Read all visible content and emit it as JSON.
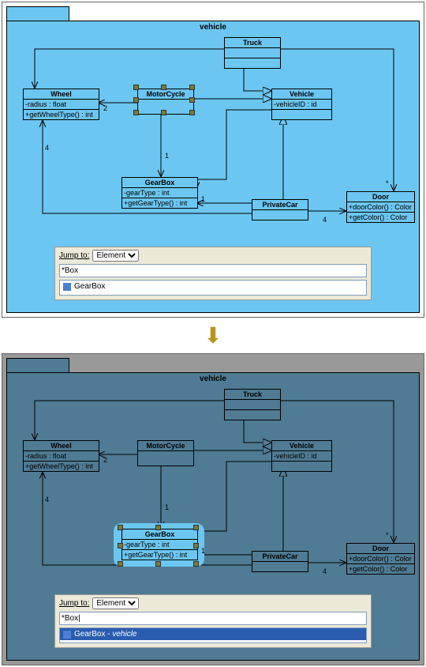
{
  "top": {
    "package": "vehicle",
    "classes": {
      "Truck": {
        "name": "Truck",
        "attrs": "",
        "ops": ""
      },
      "Wheel": {
        "name": "Wheel",
        "attrs": "-radius : float",
        "ops": "+getWheelType() : int"
      },
      "MotorCycle": {
        "name": "MotorCycle"
      },
      "Vehicle": {
        "name": "Vehicle",
        "attrs": "-vehicleID : id"
      },
      "GearBox": {
        "name": "GearBox",
        "attrs": "-gearType : int",
        "ops": "+getGearType() : int"
      },
      "PrivateCar": {
        "name": "PrivateCar"
      },
      "Door": {
        "name": "Door",
        "attrs": "+doorColor() : Color",
        "ops": "+getColor() : Color"
      }
    },
    "mults": {
      "m1": "2",
      "m2": "4",
      "m3": "1",
      "m4": "1",
      "m5": "4",
      "m6": "*"
    },
    "search": {
      "label": "Jump to:",
      "type": "Element",
      "query": "*Box",
      "result": "GearBox"
    }
  },
  "bottom": {
    "package": "vehicle",
    "classes": {
      "Truck": {
        "name": "Truck"
      },
      "Wheel": {
        "name": "Wheel",
        "attrs": "-radius : float",
        "ops": "+getWheelType() : int"
      },
      "MotorCycle": {
        "name": "MotorCycle"
      },
      "Vehicle": {
        "name": "Vehicle",
        "attrs": "-vehicleID : id"
      },
      "GearBox": {
        "name": "GearBox",
        "attrs": "-gearType : int",
        "ops": "+getGearType() : int"
      },
      "PrivateCar": {
        "name": "PrivateCar"
      },
      "Door": {
        "name": "Door",
        "attrs": "+doorColor() : Color",
        "ops": "+getColor() : Color"
      }
    },
    "mults": {
      "m1": "2",
      "m2": "4",
      "m3": "1",
      "m4": "1",
      "m5": "4",
      "m6": "*"
    },
    "search": {
      "label": "Jump to:",
      "type": "Element",
      "query": "*Box|",
      "result": "GearBox - ",
      "resultCtx": "vehicle"
    }
  },
  "arrow": "⬇"
}
